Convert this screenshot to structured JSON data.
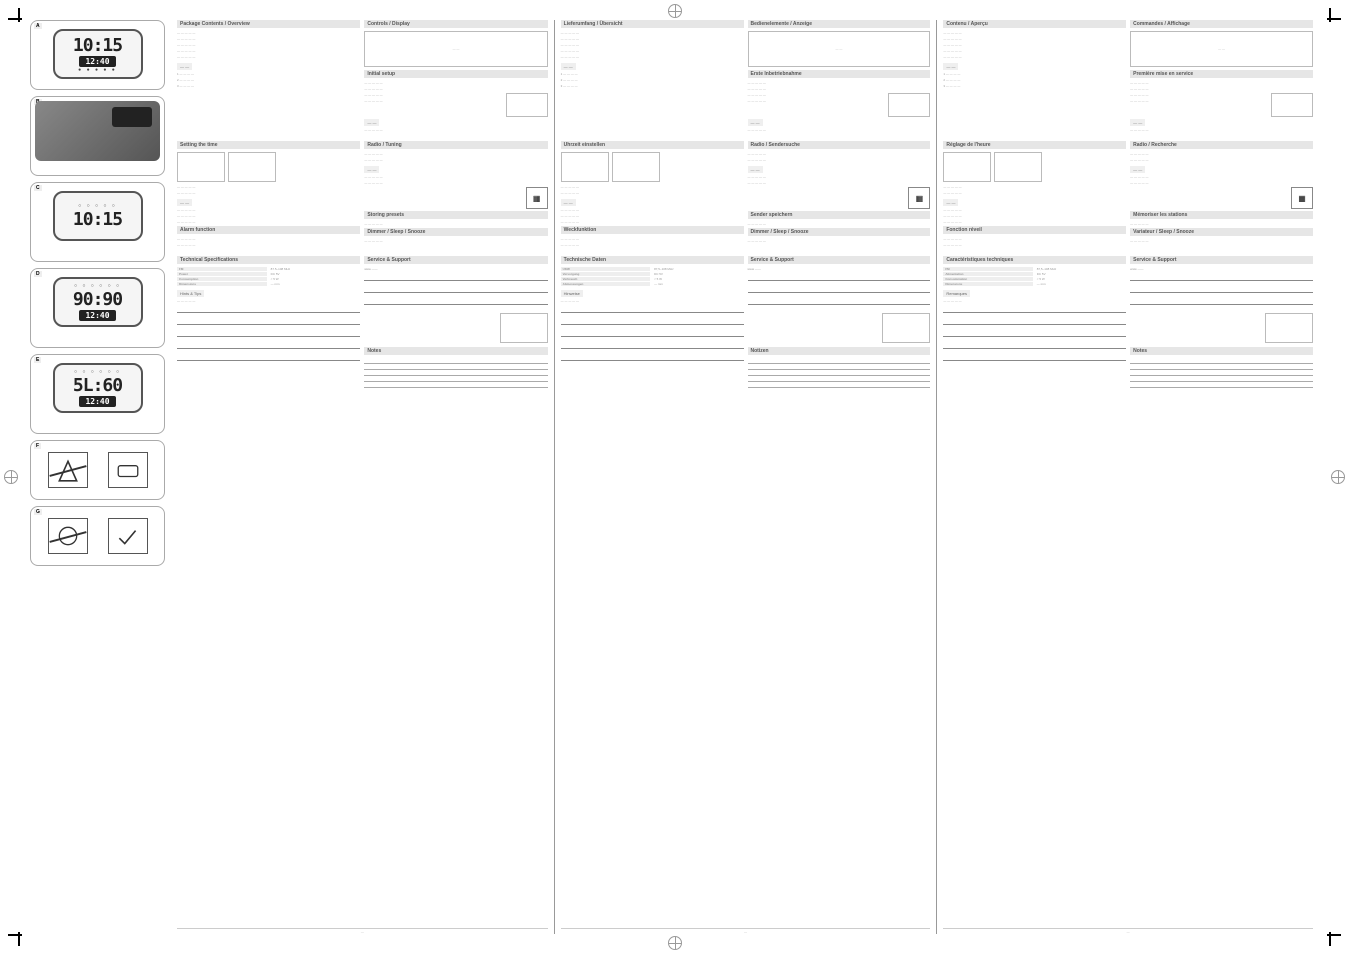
{
  "crop_marks": true,
  "figures": {
    "A": {
      "lcd_time": "10:15",
      "lcd_sub": "12:40",
      "lcd_icons": "● ● ● ● ●"
    },
    "B": {
      "device_label": ""
    },
    "C": {
      "lcd_time": "10:15",
      "lcd_sub": "",
      "lcd_icons": "○ ○ ○ ○ ○"
    },
    "D": {
      "lcd_time": "90:90",
      "lcd_sub": "12:40",
      "lcd_icons": "○ ○ ○ ○ ○ ○"
    },
    "E": {
      "lcd_time": "5L:60",
      "lcd_sub": "12:40",
      "lcd_icons": "○ ○ ○ ○ ○ ○"
    },
    "F": {
      "left_icon": "✕",
      "right_icon": "✓"
    },
    "G": {
      "left_icon": "✕",
      "right_icon": "✓"
    }
  },
  "languages": [
    {
      "code": "lang-1",
      "blocks": {
        "package_title": "Package Contents / Overview",
        "controls_title": "Controls / Display",
        "setup_title": "Initial setup",
        "time_title": "Setting the time",
        "alarm_title": "Alarm function",
        "radio_title": "Radio / Tuning",
        "preset_title": "Storing presets",
        "dimmer_title": "Dimmer / Sleep / Snooze",
        "spec_title": "Technical Specifications",
        "hints_title": "Hints & Tips",
        "support_title": "Service & Support",
        "notes_title": "Notes",
        "spec_rows": {
          "freq_h": "FM",
          "freq_v": "87.5–108 MHz",
          "power_h": "Power",
          "power_v": "DC 5V",
          "cons_h": "Consumption",
          "cons_v": "< 5 W",
          "dim_h": "Dimensions",
          "dim_v": "— mm"
        },
        "help": "www ——",
        "page": "—"
      }
    },
    {
      "code": "lang-2",
      "blocks": {
        "package_title": "Lieferumfang / Übersicht",
        "controls_title": "Bedienelemente / Anzeige",
        "setup_title": "Erste Inbetriebnahme",
        "time_title": "Uhrzeit einstellen",
        "alarm_title": "Weckfunktion",
        "radio_title": "Radio / Sendersuche",
        "preset_title": "Sender speichern",
        "dimmer_title": "Dimmer / Sleep / Snooze",
        "spec_title": "Technische Daten",
        "hints_title": "Hinweise",
        "support_title": "Service & Support",
        "notes_title": "Notizen",
        "spec_rows": {
          "freq_h": "UKW",
          "freq_v": "87,5–108 MHz",
          "power_h": "Versorgung",
          "power_v": "DC 5V",
          "cons_h": "Verbrauch",
          "cons_v": "< 5 W",
          "dim_h": "Abmessungen",
          "dim_v": "— mm"
        },
        "help": "www ——",
        "page": "—"
      }
    },
    {
      "code": "lang-3",
      "blocks": {
        "package_title": "Contenu / Aperçu",
        "controls_title": "Commandes / Affichage",
        "setup_title": "Première mise en service",
        "time_title": "Réglage de l'heure",
        "alarm_title": "Fonction réveil",
        "radio_title": "Radio / Recherche",
        "preset_title": "Mémoriser les stations",
        "dimmer_title": "Variateur / Sleep / Snooze",
        "spec_title": "Caractéristiques techniques",
        "hints_title": "Remarques",
        "support_title": "Service & Support",
        "notes_title": "Notes",
        "spec_rows": {
          "freq_h": "FM",
          "freq_v": "87,5–108 MHz",
          "power_h": "Alimentation",
          "power_v": "DC 5V",
          "cons_h": "Consommation",
          "cons_v": "< 5 W",
          "dim_h": "Dimensions",
          "dim_v": "— mm"
        },
        "help": "www ——",
        "page": "—"
      }
    }
  ]
}
